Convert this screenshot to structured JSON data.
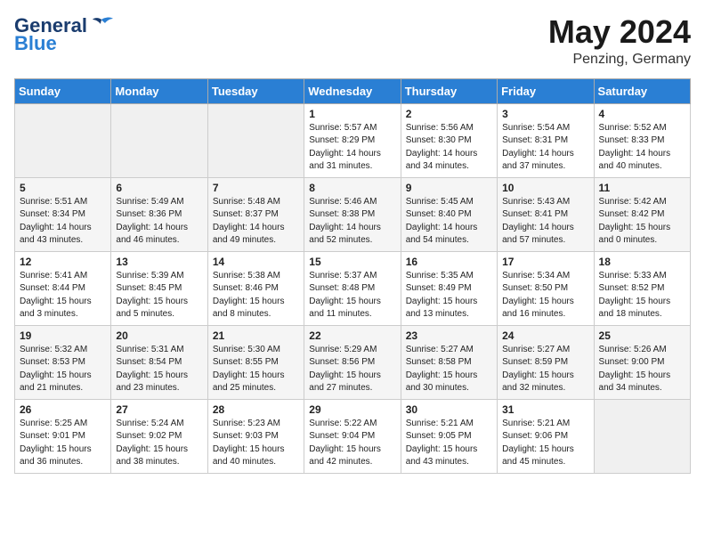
{
  "header": {
    "logo_general": "General",
    "logo_blue": "Blue",
    "month": "May 2024",
    "location": "Penzing, Germany"
  },
  "weekdays": [
    "Sunday",
    "Monday",
    "Tuesday",
    "Wednesday",
    "Thursday",
    "Friday",
    "Saturday"
  ],
  "weeks": [
    [
      {
        "day": "",
        "empty": true
      },
      {
        "day": "",
        "empty": true
      },
      {
        "day": "",
        "empty": true
      },
      {
        "day": "1",
        "sunrise": "5:57 AM",
        "sunset": "8:29 PM",
        "daylight": "14 hours and 31 minutes."
      },
      {
        "day": "2",
        "sunrise": "5:56 AM",
        "sunset": "8:30 PM",
        "daylight": "14 hours and 34 minutes."
      },
      {
        "day": "3",
        "sunrise": "5:54 AM",
        "sunset": "8:31 PM",
        "daylight": "14 hours and 37 minutes."
      },
      {
        "day": "4",
        "sunrise": "5:52 AM",
        "sunset": "8:33 PM",
        "daylight": "14 hours and 40 minutes."
      }
    ],
    [
      {
        "day": "5",
        "sunrise": "5:51 AM",
        "sunset": "8:34 PM",
        "daylight": "14 hours and 43 minutes."
      },
      {
        "day": "6",
        "sunrise": "5:49 AM",
        "sunset": "8:36 PM",
        "daylight": "14 hours and 46 minutes."
      },
      {
        "day": "7",
        "sunrise": "5:48 AM",
        "sunset": "8:37 PM",
        "daylight": "14 hours and 49 minutes."
      },
      {
        "day": "8",
        "sunrise": "5:46 AM",
        "sunset": "8:38 PM",
        "daylight": "14 hours and 52 minutes."
      },
      {
        "day": "9",
        "sunrise": "5:45 AM",
        "sunset": "8:40 PM",
        "daylight": "14 hours and 54 minutes."
      },
      {
        "day": "10",
        "sunrise": "5:43 AM",
        "sunset": "8:41 PM",
        "daylight": "14 hours and 57 minutes."
      },
      {
        "day": "11",
        "sunrise": "5:42 AM",
        "sunset": "8:42 PM",
        "daylight": "15 hours and 0 minutes."
      }
    ],
    [
      {
        "day": "12",
        "sunrise": "5:41 AM",
        "sunset": "8:44 PM",
        "daylight": "15 hours and 3 minutes."
      },
      {
        "day": "13",
        "sunrise": "5:39 AM",
        "sunset": "8:45 PM",
        "daylight": "15 hours and 5 minutes."
      },
      {
        "day": "14",
        "sunrise": "5:38 AM",
        "sunset": "8:46 PM",
        "daylight": "15 hours and 8 minutes."
      },
      {
        "day": "15",
        "sunrise": "5:37 AM",
        "sunset": "8:48 PM",
        "daylight": "15 hours and 11 minutes."
      },
      {
        "day": "16",
        "sunrise": "5:35 AM",
        "sunset": "8:49 PM",
        "daylight": "15 hours and 13 minutes."
      },
      {
        "day": "17",
        "sunrise": "5:34 AM",
        "sunset": "8:50 PM",
        "daylight": "15 hours and 16 minutes."
      },
      {
        "day": "18",
        "sunrise": "5:33 AM",
        "sunset": "8:52 PM",
        "daylight": "15 hours and 18 minutes."
      }
    ],
    [
      {
        "day": "19",
        "sunrise": "5:32 AM",
        "sunset": "8:53 PM",
        "daylight": "15 hours and 21 minutes."
      },
      {
        "day": "20",
        "sunrise": "5:31 AM",
        "sunset": "8:54 PM",
        "daylight": "15 hours and 23 minutes."
      },
      {
        "day": "21",
        "sunrise": "5:30 AM",
        "sunset": "8:55 PM",
        "daylight": "15 hours and 25 minutes."
      },
      {
        "day": "22",
        "sunrise": "5:29 AM",
        "sunset": "8:56 PM",
        "daylight": "15 hours and 27 minutes."
      },
      {
        "day": "23",
        "sunrise": "5:27 AM",
        "sunset": "8:58 PM",
        "daylight": "15 hours and 30 minutes."
      },
      {
        "day": "24",
        "sunrise": "5:27 AM",
        "sunset": "8:59 PM",
        "daylight": "15 hours and 32 minutes."
      },
      {
        "day": "25",
        "sunrise": "5:26 AM",
        "sunset": "9:00 PM",
        "daylight": "15 hours and 34 minutes."
      }
    ],
    [
      {
        "day": "26",
        "sunrise": "5:25 AM",
        "sunset": "9:01 PM",
        "daylight": "15 hours and 36 minutes."
      },
      {
        "day": "27",
        "sunrise": "5:24 AM",
        "sunset": "9:02 PM",
        "daylight": "15 hours and 38 minutes."
      },
      {
        "day": "28",
        "sunrise": "5:23 AM",
        "sunset": "9:03 PM",
        "daylight": "15 hours and 40 minutes."
      },
      {
        "day": "29",
        "sunrise": "5:22 AM",
        "sunset": "9:04 PM",
        "daylight": "15 hours and 42 minutes."
      },
      {
        "day": "30",
        "sunrise": "5:21 AM",
        "sunset": "9:05 PM",
        "daylight": "15 hours and 43 minutes."
      },
      {
        "day": "31",
        "sunrise": "5:21 AM",
        "sunset": "9:06 PM",
        "daylight": "15 hours and 45 minutes."
      },
      {
        "day": "",
        "empty": true
      }
    ]
  ]
}
